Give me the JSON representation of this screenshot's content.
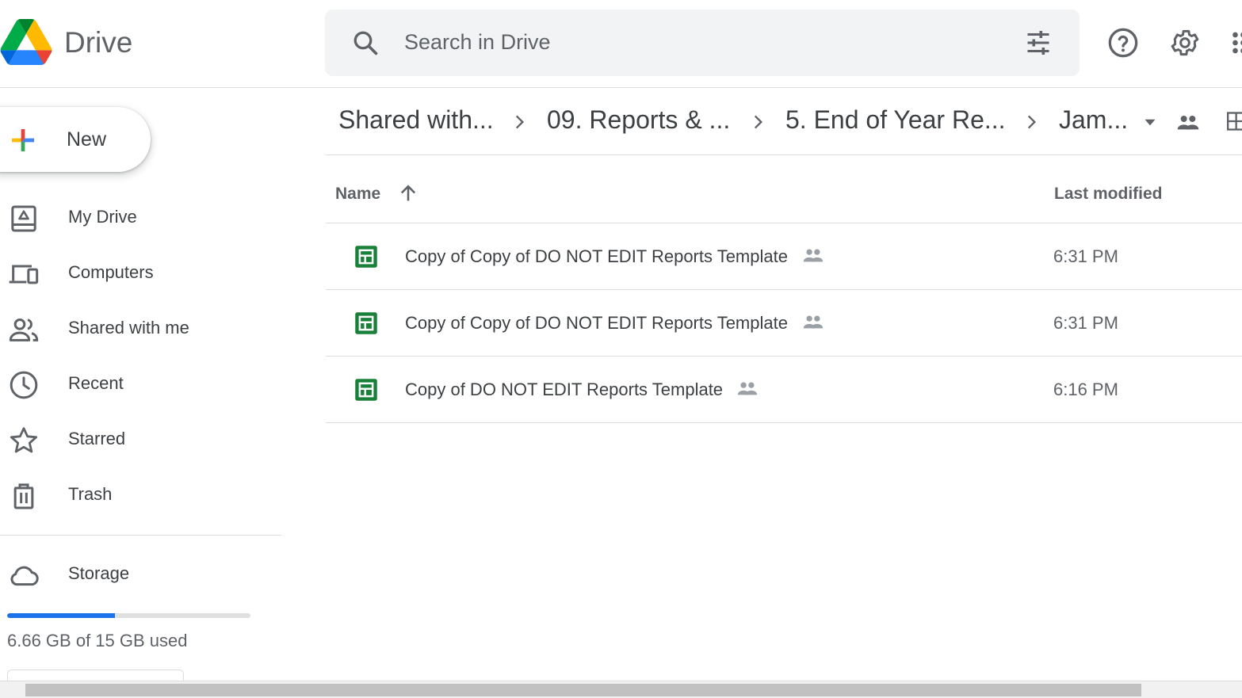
{
  "app": {
    "brand": "Drive"
  },
  "search": {
    "placeholder": "Search in Drive"
  },
  "sidebar": {
    "new_label": "New",
    "items": [
      {
        "label": "My Drive",
        "icon": "my-drive-icon"
      },
      {
        "label": "Computers",
        "icon": "computers-icon"
      },
      {
        "label": "Shared with me",
        "icon": "people-icon"
      },
      {
        "label": "Recent",
        "icon": "clock-icon"
      },
      {
        "label": "Starred",
        "icon": "star-icon"
      },
      {
        "label": "Trash",
        "icon": "trash-icon"
      }
    ],
    "storage_label": "Storage",
    "storage_used_text": "6.66 GB of 15 GB used",
    "storage_used_fraction": 0.444
  },
  "breadcrumb": [
    "Shared with...",
    "09. Reports & ...",
    "5. End of Year Re...",
    "Jam..."
  ],
  "list": {
    "header_name": "Name",
    "header_modified": "Last modified",
    "files": [
      {
        "name": "Copy of Copy of DO NOT EDIT Reports Template",
        "modified": "6:31 PM"
      },
      {
        "name": "Copy of Copy of DO NOT EDIT Reports Template",
        "modified": "6:31 PM"
      },
      {
        "name": "Copy of DO NOT EDIT Reports Template",
        "modified": "6:16 PM"
      }
    ]
  },
  "colors": {
    "accent": "#1a73e8",
    "sheets_green": "#188038",
    "icon_gray": "#5f6368"
  }
}
